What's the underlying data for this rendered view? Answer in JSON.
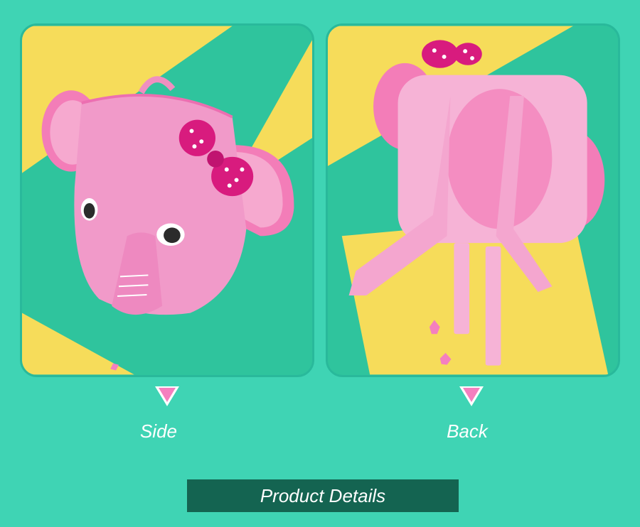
{
  "colors": {
    "background": "#3fd4b4",
    "panel_green": "#2fc49d",
    "panel_yellow": "#f6dc5a",
    "bag_pink": "#f19ac9",
    "accent_pink": "#f47fbf",
    "bar_dark": "#146451"
  },
  "views": [
    {
      "caption": "Side",
      "arrow_icon": "down-triangle-icon"
    },
    {
      "caption": "Back",
      "arrow_icon": "down-triangle-icon"
    }
  ],
  "footer": {
    "label": "Product Details"
  }
}
